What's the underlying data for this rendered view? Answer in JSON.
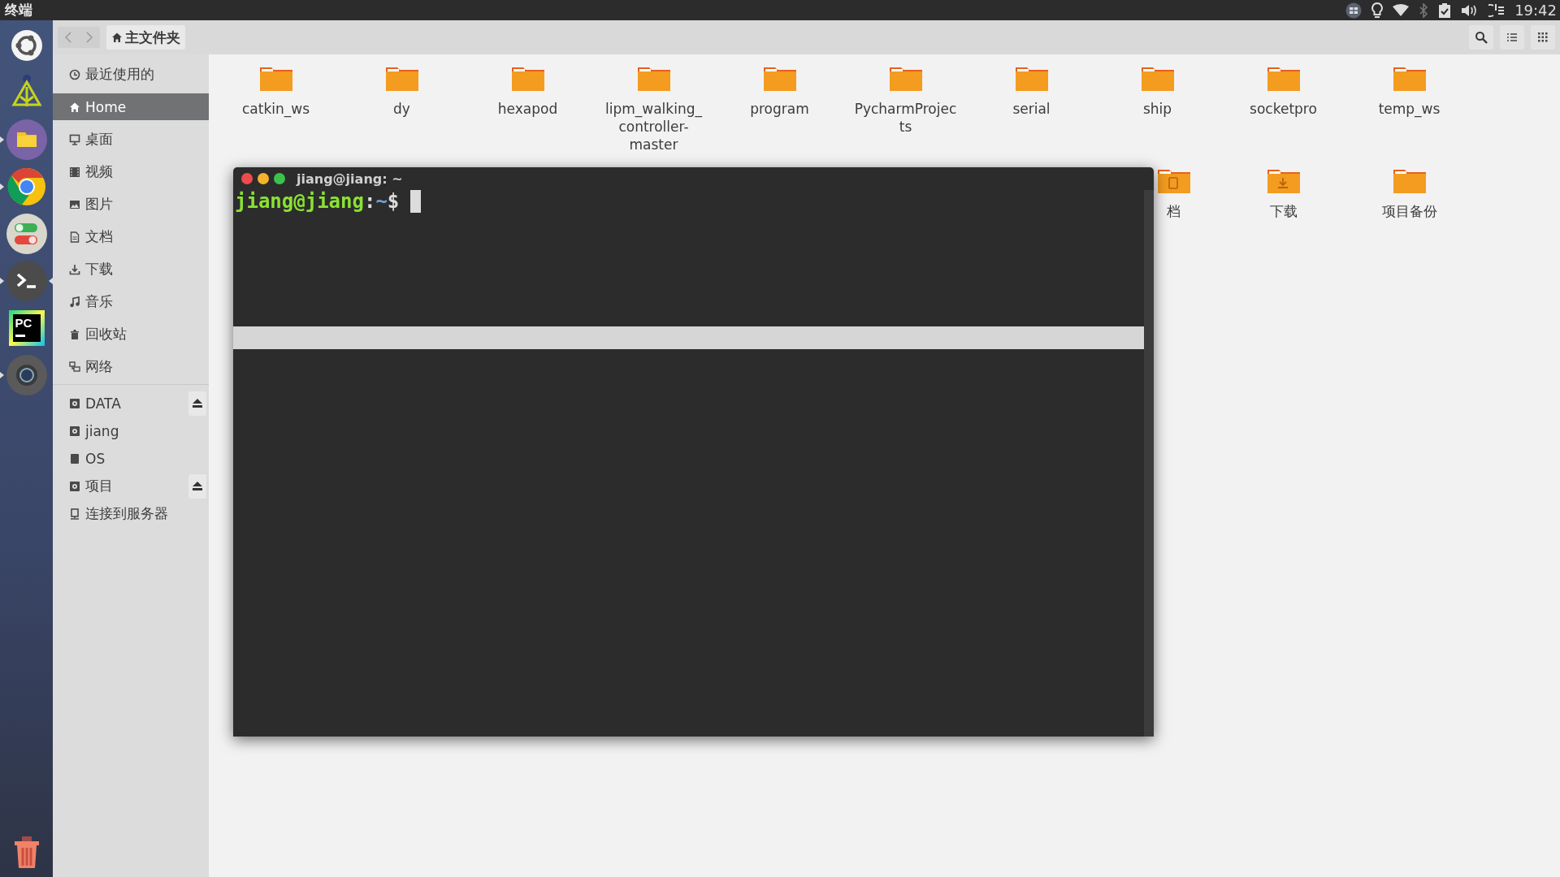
{
  "top_panel": {
    "title": "终端",
    "clock": "19:42",
    "indicators": [
      {
        "kind": "keyboard",
        "disabled": false
      },
      {
        "kind": "bulb",
        "disabled": false
      },
      {
        "kind": "wifi",
        "disabled": false
      },
      {
        "kind": "bluetooth",
        "disabled": true
      },
      {
        "kind": "clipboard",
        "disabled": false
      },
      {
        "kind": "volume",
        "disabled": false
      },
      {
        "kind": "power",
        "disabled": false
      }
    ]
  },
  "launcher": [
    {
      "kind": "ubuntu",
      "running": false,
      "focused": false
    },
    {
      "kind": "tree",
      "running": false,
      "focused": false
    },
    {
      "kind": "files",
      "running": true,
      "focused": false
    },
    {
      "kind": "browser",
      "running": true,
      "focused": false
    },
    {
      "kind": "toggles",
      "running": false,
      "focused": false
    },
    {
      "kind": "terminal",
      "running": true,
      "focused": true
    },
    {
      "kind": "ide",
      "text": "PC",
      "running": false,
      "focused": false
    },
    {
      "kind": "camera",
      "running": true,
      "focused": false
    }
  ],
  "toolbar": {
    "path": "主文件夹"
  },
  "sidebar": {
    "places": [
      {
        "kind": "recent",
        "label": "最近使用的",
        "selected": false
      },
      {
        "kind": "home",
        "label": "Home",
        "selected": true
      },
      {
        "kind": "desktop",
        "label": "桌面",
        "selected": false
      },
      {
        "kind": "video",
        "label": "视频",
        "selected": false
      },
      {
        "kind": "picture",
        "label": "图片",
        "selected": false
      },
      {
        "kind": "document",
        "label": "文档",
        "selected": false
      },
      {
        "kind": "download",
        "label": "下载",
        "selected": false
      },
      {
        "kind": "music",
        "label": "音乐",
        "selected": false
      },
      {
        "kind": "trash",
        "label": "回收站",
        "selected": false
      },
      {
        "kind": "network",
        "label": "网络",
        "selected": false
      }
    ],
    "devices": [
      {
        "kind": "drive",
        "label": "DATA",
        "eject": true
      },
      {
        "kind": "drive",
        "label": "jiang",
        "eject": false
      },
      {
        "kind": "disk",
        "label": "OS",
        "eject": false
      },
      {
        "kind": "drive",
        "label": "项目",
        "eject": true
      }
    ],
    "connect": {
      "kind": "server",
      "label": "连接到服务器"
    }
  },
  "files": [
    {
      "kind": "folder",
      "name": "catkin_ws"
    },
    {
      "kind": "folder",
      "name": "dy"
    },
    {
      "kind": "folder",
      "name": "hexapod"
    },
    {
      "kind": "folder",
      "name": "lipm_walking_\ncontroller-\nmaster"
    },
    {
      "kind": "folder",
      "name": "program"
    },
    {
      "kind": "folder",
      "name": "PycharmProjec\nts"
    },
    {
      "kind": "folder",
      "name": "serial"
    },
    {
      "kind": "folder",
      "name": "ship"
    },
    {
      "kind": "folder",
      "name": "socketpro"
    },
    {
      "kind": "folder",
      "name": "temp_ws"
    }
  ],
  "files_row_2": [
    {
      "kind": "document",
      "name": "档"
    },
    {
      "kind": "download",
      "name": "下载"
    },
    {
      "kind": "folder",
      "name": "项目备份"
    }
  ],
  "terminal": {
    "title": "jiang@jiang: ~",
    "prompt_user": "jiang@jiang",
    "prompt_sep": ":",
    "prompt_path": "~",
    "prompt_symbol": "$"
  }
}
